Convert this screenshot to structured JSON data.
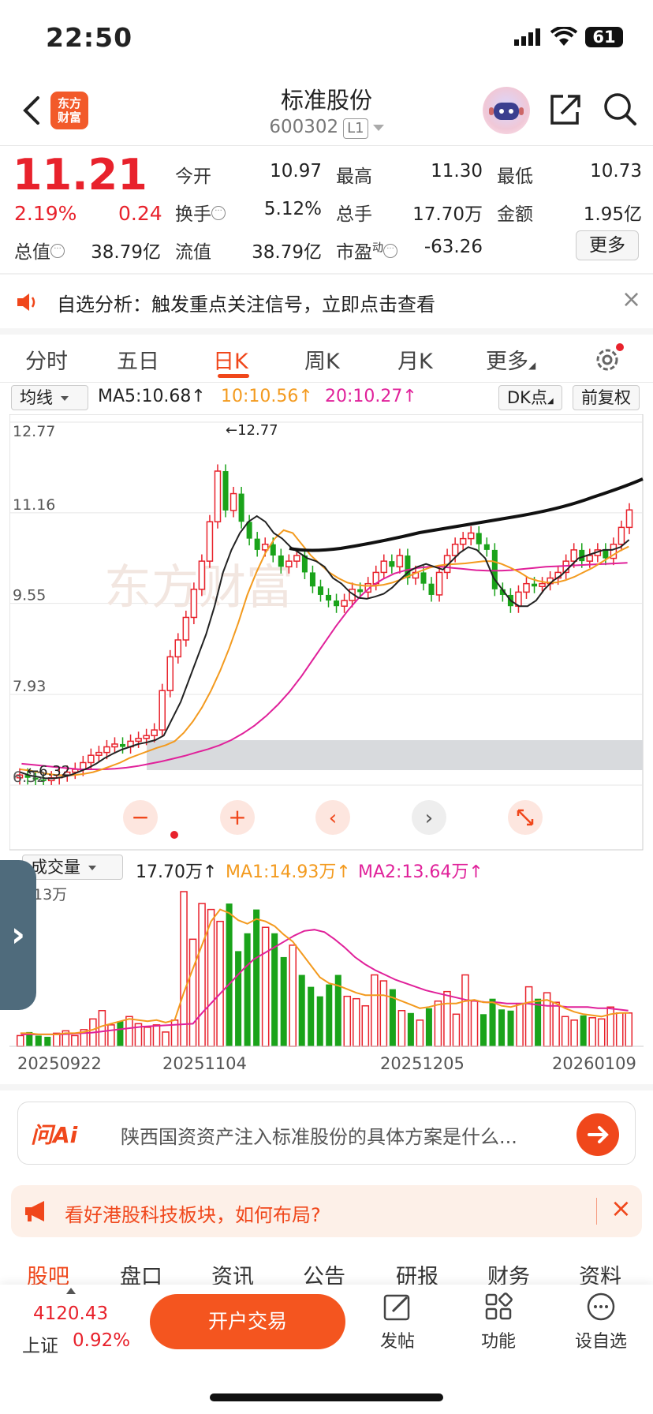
{
  "status_bar": {
    "time": "22:50",
    "battery": "61"
  },
  "header": {
    "title": "标准股份",
    "code": "600302",
    "level": "L1",
    "logo_text": "东方\n财富"
  },
  "quote": {
    "price": "11.21",
    "change_pct": "2.19%",
    "change_amt": "0.24",
    "fields": [
      {
        "label": "今开",
        "value": "10.97",
        "color": "#222"
      },
      {
        "label": "最高",
        "value": "11.30",
        "color": "#e8222c"
      },
      {
        "label": "最低",
        "value": "10.73",
        "color": "#1aa31a"
      },
      {
        "label": "换手",
        "value": "5.12%",
        "color": "#222"
      },
      {
        "label": "总手",
        "value": "17.70万",
        "color": "#222"
      },
      {
        "label": "金额",
        "value": "1.95亿",
        "color": "#222"
      },
      {
        "label": "总值",
        "value": "38.79亿",
        "color": "#222"
      },
      {
        "label": "流值",
        "value": "38.79亿",
        "color": "#222"
      },
      {
        "label": "市盈",
        "label_sup": "动",
        "value": "-63.26",
        "color": "#222"
      }
    ],
    "more_label": "更多"
  },
  "notice": {
    "text": "自选分析：触发重点关注信号，立即点击查看"
  },
  "chart_tabs": [
    "分时",
    "五日",
    "日K",
    "周K",
    "月K",
    "更多"
  ],
  "indicators": {
    "ma_select": "均线",
    "ma5": "MA5:10.68↑",
    "ma10": "10:10.56↑",
    "ma20": "20:10.27↑",
    "dk": "DK点",
    "adjust": "前复权",
    "ma5_color": "#222222",
    "ma10_color": "#f39a1e",
    "ma20_color": "#e0219a"
  },
  "volume": {
    "select": "成交量",
    "value": "17.70万↑",
    "ma1": "MA1:14.93万↑",
    "ma2": "MA2:13.64万↑",
    "max_label": "13万"
  },
  "chart_data": {
    "type": "candlestick",
    "y_ticks": [
      "12.77",
      "11.16",
      "9.55",
      "7.93",
      "6.32"
    ],
    "ylim": [
      6.32,
      12.77
    ],
    "high_annotation": "←12.77",
    "low_annotation": "←6.32",
    "x_ticks": [
      "20250922",
      "20251104",
      "20251205",
      "20260109"
    ],
    "close_series": [
      6.5,
      6.45,
      6.42,
      6.4,
      6.45,
      6.5,
      6.55,
      6.6,
      6.72,
      6.85,
      6.9,
      7.0,
      7.05,
      7.0,
      7.1,
      7.15,
      7.2,
      7.3,
      8.0,
      8.6,
      8.9,
      9.3,
      9.8,
      10.3,
      11.0,
      11.9,
      11.2,
      11.5,
      11.0,
      10.7,
      10.5,
      10.6,
      10.4,
      10.2,
      10.3,
      10.4,
      10.1,
      9.85,
      9.7,
      9.6,
      9.5,
      9.6,
      9.8,
      9.75,
      9.9,
      10.1,
      10.3,
      10.2,
      10.4,
      10.0,
      10.1,
      9.9,
      9.7,
      10.1,
      10.4,
      10.6,
      10.7,
      10.8,
      10.6,
      10.5,
      9.8,
      9.7,
      9.5,
      9.75,
      9.9,
      9.85,
      9.9,
      10.0,
      10.1,
      10.3,
      10.5,
      10.3,
      10.4,
      10.5,
      10.35,
      10.6,
      10.9,
      11.21
    ],
    "ma5_series": [
      6.55,
      6.5,
      6.47,
      6.44,
      6.44,
      6.46,
      6.5,
      6.56,
      6.62,
      6.7,
      6.8,
      6.88,
      6.95,
      7.0,
      7.05,
      7.08,
      7.12,
      7.2,
      7.5,
      7.8,
      8.2,
      8.6,
      9.0,
      9.5,
      10.1,
      10.5,
      10.8,
      11.0,
      11.1,
      11.0,
      10.8,
      10.7,
      10.55,
      10.45,
      10.35,
      10.3,
      10.2,
      10.0,
      9.9,
      9.75,
      9.65,
      9.63,
      9.67,
      9.72,
      9.83,
      9.98,
      10.12,
      10.2,
      10.25,
      10.2,
      10.15,
      10.3,
      10.45,
      10.55,
      10.5,
      10.35,
      10.0,
      9.8,
      9.6,
      9.5,
      9.5,
      9.6,
      9.8,
      9.95,
      10.05,
      10.2,
      10.35,
      10.4,
      10.45,
      10.5,
      10.5,
      10.55,
      10.68
    ],
    "ma10_series": [
      6.6,
      6.58,
      6.55,
      6.52,
      6.5,
      6.49,
      6.5,
      6.52,
      6.55,
      6.6,
      6.66,
      6.72,
      6.8,
      6.86,
      6.92,
      6.98,
      7.03,
      7.1,
      7.25,
      7.45,
      7.7,
      8.0,
      8.35,
      8.75,
      9.2,
      9.7,
      10.1,
      10.45,
      10.7,
      10.85,
      10.8,
      10.6,
      10.4,
      10.25,
      10.1,
      10.0,
      9.92,
      9.88,
      9.86,
      9.86,
      9.88,
      9.92,
      9.98,
      10.05,
      10.12,
      10.18,
      10.22,
      10.24,
      10.25,
      10.26,
      10.28,
      10.3,
      10.3,
      10.25,
      10.18,
      10.1,
      10.0,
      9.95,
      9.92,
      9.92,
      9.96,
      10.02,
      10.1,
      10.18,
      10.28,
      10.38,
      10.48,
      10.56
    ],
    "ma20_series": [
      6.7,
      6.68,
      6.66,
      6.64,
      6.62,
      6.6,
      6.6,
      6.6,
      6.61,
      6.63,
      6.66,
      6.7,
      6.74,
      6.79,
      6.84,
      6.9,
      6.96,
      7.03,
      7.12,
      7.24,
      7.38,
      7.55,
      7.75,
      7.98,
      8.25,
      8.55,
      8.85,
      9.15,
      9.42,
      9.66,
      9.85,
      9.98,
      10.08,
      10.14,
      10.18,
      10.2,
      10.2,
      10.18,
      10.16,
      10.14,
      10.13,
      10.13,
      10.14,
      10.16,
      10.18,
      10.2,
      10.21,
      10.22,
      10.23,
      10.24,
      10.25,
      10.26,
      10.27
    ],
    "volume_series": [
      0.9,
      1.2,
      0.9,
      0.8,
      1.1,
      1.3,
      0.9,
      1.4,
      2.3,
      3.0,
      1.8,
      2.1,
      2.5,
      1.9,
      1.6,
      1.8,
      1.2,
      2.2,
      13.0,
      9.0,
      12.0,
      11.5,
      10.5,
      12.0,
      8.0,
      9.5,
      11.5,
      10.0,
      9.5,
      7.5,
      8.5,
      6.0,
      5.0,
      4.2,
      5.2,
      6.0,
      4.2,
      4.0,
      3.4,
      6.0,
      5.5,
      4.8,
      3.0,
      2.8,
      2.2,
      3.2,
      3.8,
      4.6,
      2.7,
      6.0,
      3.8,
      2.7,
      4.0,
      3.1,
      3.0,
      3.6,
      5.0,
      4.0,
      4.5,
      3.7,
      2.5,
      2.2,
      2.6,
      2.4,
      2.3,
      3.3,
      2.8,
      2.8
    ],
    "vol_ma1_series": [
      1.1,
      1.1,
      1.0,
      1.0,
      1.0,
      1.1,
      1.1,
      1.2,
      1.4,
      1.7,
      1.9,
      2.1,
      2.3,
      2.2,
      2.1,
      2.2,
      2.0,
      2.2,
      4.5,
      6.5,
      8.5,
      10.5,
      11.5,
      11.2,
      10.6,
      10.3,
      10.7,
      10.5,
      10.1,
      9.4,
      8.8,
      7.8,
      6.8,
      5.8,
      5.3,
      5.1,
      4.8,
      4.5,
      4.3,
      4.3,
      4.3,
      4.1,
      3.8,
      3.5,
      3.2,
      3.3,
      3.5,
      3.6,
      3.6,
      3.8,
      3.9,
      3.7,
      3.7,
      3.4,
      3.3,
      3.5,
      3.7,
      3.8,
      3.9,
      3.6,
      3.2,
      2.9,
      2.7,
      2.6,
      2.5,
      2.7,
      2.8,
      2.8
    ],
    "vol_ma2_series": [
      1.0,
      1.0,
      1.0,
      1.0,
      1.0,
      1.05,
      1.1,
      1.15,
      1.25,
      1.35,
      1.45,
      1.55,
      1.65,
      1.7,
      1.75,
      1.8,
      1.85,
      1.9,
      2.9,
      3.8,
      4.7,
      5.6,
      6.5,
      7.3,
      7.8,
      8.3,
      8.8,
      9.3,
      9.7,
      9.8,
      9.6,
      9.0,
      8.3,
      7.5,
      6.9,
      6.4,
      6.0,
      5.6,
      5.3,
      5.0,
      4.7,
      4.5,
      4.3,
      4.1,
      3.9,
      3.8,
      3.7,
      3.7,
      3.6,
      3.6,
      3.6,
      3.5,
      3.4,
      3.4,
      3.3,
      3.3,
      3.3,
      3.2,
      3.2,
      3.1,
      3.0
    ]
  },
  "ask_ai": {
    "logo": "问Ai",
    "text": "陕西国资资产注入标准股份的具体方案是什么..."
  },
  "promo": {
    "text": "看好港股科技板块，如何布局?"
  },
  "bottom_tabs": [
    "股吧",
    "盘口",
    "资讯",
    "公告",
    "研报",
    "财务",
    "资料"
  ],
  "bottom_bar": {
    "index_value": "4120.43",
    "index_name": "上证",
    "index_pct": "0.92%",
    "trade_label": "开户交易",
    "post_label": "发帖",
    "func_label": "功能",
    "watch_label": "设自选"
  }
}
